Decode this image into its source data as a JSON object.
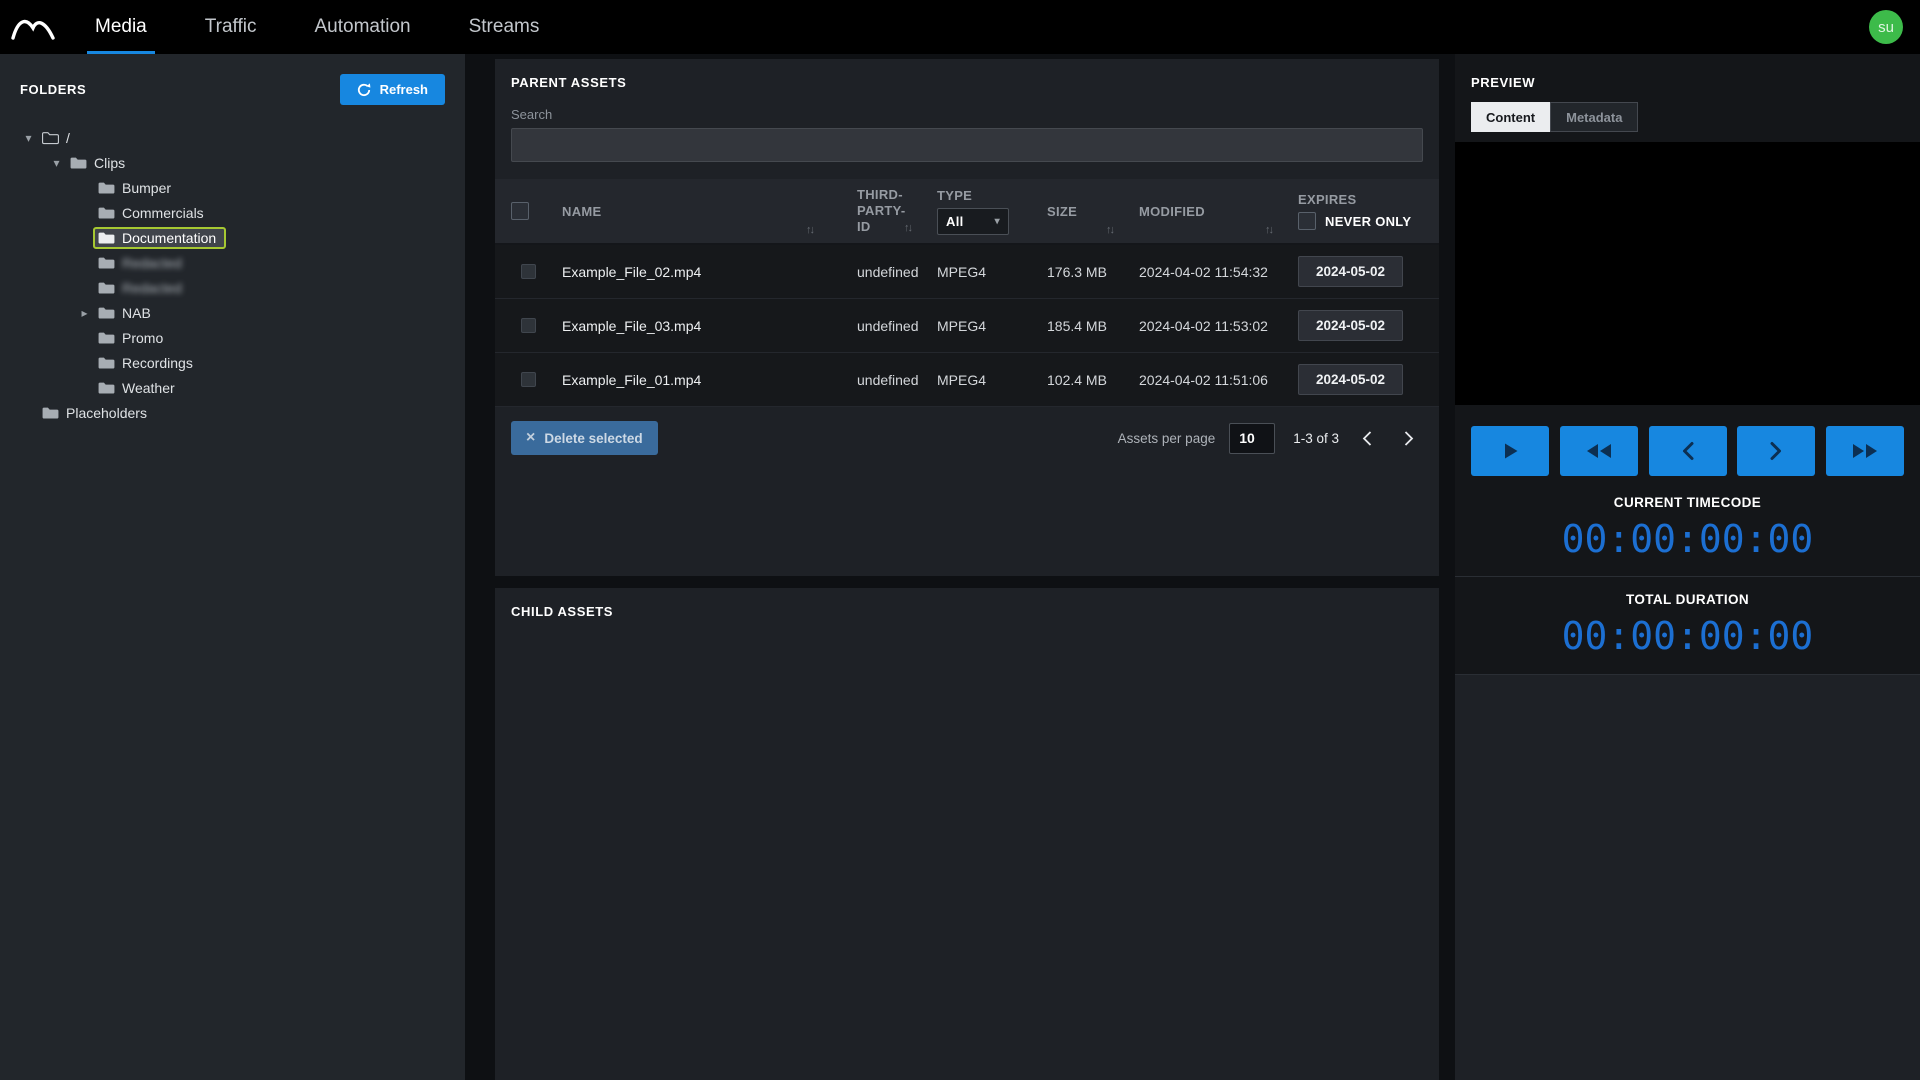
{
  "topbar": {
    "nav_items": [
      {
        "label": "Media",
        "active": true
      },
      {
        "label": "Traffic",
        "active": false
      },
      {
        "label": "Automation",
        "active": false
      },
      {
        "label": "Streams",
        "active": false
      }
    ],
    "avatar_label": "su"
  },
  "folders_panel": {
    "title": "FOLDERS",
    "refresh_button": "Refresh",
    "tree": [
      {
        "label": "/",
        "level": 0,
        "state": "expanded",
        "icon": "outline"
      },
      {
        "label": "Clips",
        "level": 1,
        "state": "expanded"
      },
      {
        "label": "Bumper",
        "level": 2,
        "state": "leaf"
      },
      {
        "label": "Commercials",
        "level": 2,
        "state": "leaf"
      },
      {
        "label": "Documentation",
        "level": 2,
        "state": "leaf",
        "selected": true
      },
      {
        "label": "Redacted",
        "level": 2,
        "state": "leaf",
        "blurred": true
      },
      {
        "label": "Redacted",
        "level": 2,
        "state": "leaf",
        "blurred": true
      },
      {
        "label": "NAB",
        "level": 2,
        "state": "collapsed"
      },
      {
        "label": "Promo",
        "level": 2,
        "state": "leaf"
      },
      {
        "label": "Recordings",
        "level": 2,
        "state": "leaf"
      },
      {
        "label": "Weather",
        "level": 2,
        "state": "leaf"
      },
      {
        "label": "Placeholders",
        "level": 0,
        "state": "leaf"
      }
    ]
  },
  "parent_assets": {
    "title": "PARENT ASSETS",
    "search_label": "Search",
    "search_value": "",
    "columns": {
      "name": "NAME",
      "third_party_id": "THIRD-PARTY-ID",
      "type": "TYPE",
      "type_filter_value": "All",
      "size": "SIZE",
      "modified": "MODIFIED",
      "expires": "EXPIRES",
      "never_only": "NEVER ONLY"
    },
    "rows": [
      {
        "name": "Example_File_02.mp4",
        "third_party_id": "undefined",
        "type": "MPEG4",
        "size": "176.3 MB",
        "modified": "2024-04-02 11:54:32",
        "expires": "2024-05-02"
      },
      {
        "name": "Example_File_03.mp4",
        "third_party_id": "undefined",
        "type": "MPEG4",
        "size": "185.4 MB",
        "modified": "2024-04-02 11:53:02",
        "expires": "2024-05-02"
      },
      {
        "name": "Example_File_01.mp4",
        "third_party_id": "undefined",
        "type": "MPEG4",
        "size": "102.4 MB",
        "modified": "2024-04-02 11:51:06",
        "expires": "2024-05-02"
      }
    ],
    "delete_button": "Delete selected",
    "per_page_label": "Assets per page",
    "per_page_value": "10",
    "range_text": "1-3 of 3"
  },
  "child_assets": {
    "title": "CHILD ASSETS"
  },
  "preview_panel": {
    "title": "PREVIEW",
    "tabs": [
      {
        "label": "Content",
        "active": true
      },
      {
        "label": "Metadata",
        "active": false
      }
    ],
    "current_timecode_label": "CURRENT TIMECODE",
    "current_timecode": "00:00:00:00",
    "total_duration_label": "TOTAL DURATION",
    "total_duration": "00:00:00:00"
  },
  "icons": {
    "sort": "↑↓",
    "caret_down": "▾",
    "tree_expanded": "▾",
    "tree_collapsed": "▸",
    "close": "×"
  },
  "colors": {
    "accent_blue": "#1787e0",
    "timecode_blue": "#1c6fd2",
    "selected_folder_green": "#a6c832",
    "avatar_green": "#3dbb4a"
  }
}
